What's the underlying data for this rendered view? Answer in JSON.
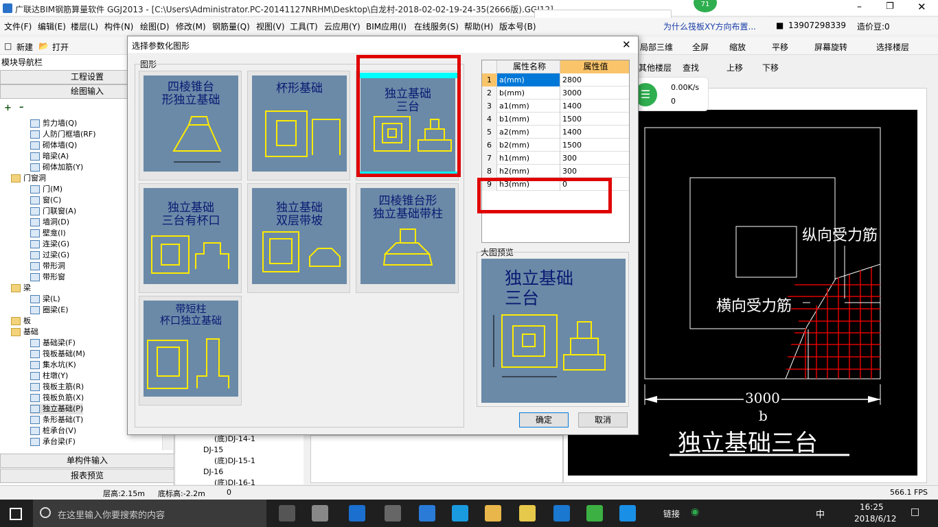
{
  "app": {
    "title": "广联达BIM钢筋算量软件 GGJ2013 - [C:\\Users\\Administrator.PC-20141127NRHM\\Desktop\\白龙村-2018-02-02-19-24-35(2666版).GGJ12]",
    "badge": "71"
  },
  "menu": [
    "文件(F)",
    "编辑(E)",
    "楼层(L)",
    "构件(N)",
    "绘图(D)",
    "修改(M)",
    "钢筋量(Q)",
    "视图(V)",
    "工具(T)",
    "云应用(Y)",
    "BIM应用(I)",
    "在线服务(S)",
    "帮助(H)",
    "版本号(B)"
  ],
  "menu_right": {
    "question": "为什么筏板XY方向布置...",
    "phone": "13907298339",
    "cost": "造价豆:0"
  },
  "toolbar": {
    "new": "新建",
    "open": "打开",
    "local3d": "局部三维",
    "fullscreen": "全屏",
    "zoom": "缩放",
    "pan": "平移",
    "rotate": "屏幕旋转",
    "select_floor": "选择楼层",
    "other_floor": "其他楼层",
    "find": "查找",
    "up": "上移",
    "down": "下移"
  },
  "leftpane": {
    "title": "模块导航栏",
    "btn_project": "工程设置",
    "btn_draw": "绘图输入",
    "btn_single": "单构件输入",
    "btn_report": "报表预览",
    "tree": [
      {
        "label": "剪力墙(Q)",
        "type": "item",
        "indent": 2
      },
      {
        "label": "人防门框墙(RF)",
        "type": "item",
        "indent": 2
      },
      {
        "label": "砌体墙(Q)",
        "type": "item",
        "indent": 2
      },
      {
        "label": "暗梁(A)",
        "type": "item",
        "indent": 2
      },
      {
        "label": "砌体加筋(Y)",
        "type": "item",
        "indent": 2
      },
      {
        "label": "门窗洞",
        "type": "folder",
        "indent": 1
      },
      {
        "label": "门(M)",
        "type": "item",
        "indent": 2
      },
      {
        "label": "窗(C)",
        "type": "item",
        "indent": 2
      },
      {
        "label": "门联窗(A)",
        "type": "item",
        "indent": 2
      },
      {
        "label": "墙洞(D)",
        "type": "item",
        "indent": 2
      },
      {
        "label": "壁龛(I)",
        "type": "item",
        "indent": 2
      },
      {
        "label": "连梁(G)",
        "type": "item",
        "indent": 2
      },
      {
        "label": "过梁(G)",
        "type": "item",
        "indent": 2
      },
      {
        "label": "带形洞",
        "type": "item",
        "indent": 2
      },
      {
        "label": "带形窗",
        "type": "item",
        "indent": 2
      },
      {
        "label": "梁",
        "type": "folder",
        "indent": 1
      },
      {
        "label": "梁(L)",
        "type": "item",
        "indent": 2
      },
      {
        "label": "圈梁(E)",
        "type": "item",
        "indent": 2
      },
      {
        "label": "板",
        "type": "folder",
        "indent": 1
      },
      {
        "label": "基础",
        "type": "folder",
        "indent": 1
      },
      {
        "label": "基础梁(F)",
        "type": "item",
        "indent": 2
      },
      {
        "label": "筏板基础(M)",
        "type": "item",
        "indent": 2
      },
      {
        "label": "集水坑(K)",
        "type": "item",
        "indent": 2
      },
      {
        "label": "柱墩(Y)",
        "type": "item",
        "indent": 2
      },
      {
        "label": "筏板主筋(R)",
        "type": "item",
        "indent": 2
      },
      {
        "label": "筏板负筋(X)",
        "type": "item",
        "indent": 2
      },
      {
        "label": "独立基础(P)",
        "type": "item",
        "indent": 2,
        "selected": true
      },
      {
        "label": "条形基础(T)",
        "type": "item",
        "indent": 2
      },
      {
        "label": "桩承台(V)",
        "type": "item",
        "indent": 2
      },
      {
        "label": "承台梁(F)",
        "type": "item",
        "indent": 2
      }
    ]
  },
  "midtree": [
    "(底)DJ-14-1",
    "DJ-15",
    "(底)DJ-15-1",
    "DJ-16",
    "(底)DJ-16-1"
  ],
  "dialog": {
    "title": "选择参数化图形",
    "group_label": "图形",
    "shapes": [
      {
        "caption": "四棱锥台\n形独立基础"
      },
      {
        "caption": "杯形基础"
      },
      {
        "caption": "独立基础\n三台"
      },
      {
        "caption": "独立基础\n三台有杯口"
      },
      {
        "caption": "独立基础\n双层带坡"
      },
      {
        "caption": "四棱锥台形\n独立基础带柱"
      },
      {
        "caption": "带短柱\n杯口独立基础"
      }
    ],
    "table_headers": {
      "name": "属性名称",
      "value": "属性值"
    },
    "props": [
      {
        "n": "1",
        "k": "a(mm)",
        "v": "2800"
      },
      {
        "n": "2",
        "k": "b(mm)",
        "v": "3000"
      },
      {
        "n": "3",
        "k": "a1(mm)",
        "v": "1400"
      },
      {
        "n": "4",
        "k": "b1(mm)",
        "v": "1500"
      },
      {
        "n": "5",
        "k": "a2(mm)",
        "v": "1400"
      },
      {
        "n": "6",
        "k": "b2(mm)",
        "v": "1500"
      },
      {
        "n": "7",
        "k": "h1(mm)",
        "v": "300"
      },
      {
        "n": "8",
        "k": "h2(mm)",
        "v": "300"
      },
      {
        "n": "9",
        "k": "h3(mm)",
        "v": "0"
      }
    ],
    "preview_label": "大图预览",
    "preview_title": "独立基础\n三台",
    "ok": "确定",
    "cancel": "取消"
  },
  "network": {
    "speed": "0.00K/s",
    "count": "0"
  },
  "canvas": {
    "label_vertical": "纵向受力筋",
    "label_horizontal": "横向受力筋",
    "dim": "3000",
    "dim_letter": "b",
    "title": "独立基础三台"
  },
  "status": {
    "floor_height": "层高:2.15m",
    "bottom_height": "底标高:-2.2m",
    "zero": "0",
    "fps": "566.1 FPS"
  },
  "taskbar": {
    "search": "在这里输入你要搜索的内容",
    "link": "链接",
    "ime": "中",
    "time": "16:25",
    "date": "2018/6/12"
  },
  "colors": {
    "dialog_thumb": "#6b8aa8",
    "highlight": "#e00000",
    "canvas_bg": "#000000"
  }
}
